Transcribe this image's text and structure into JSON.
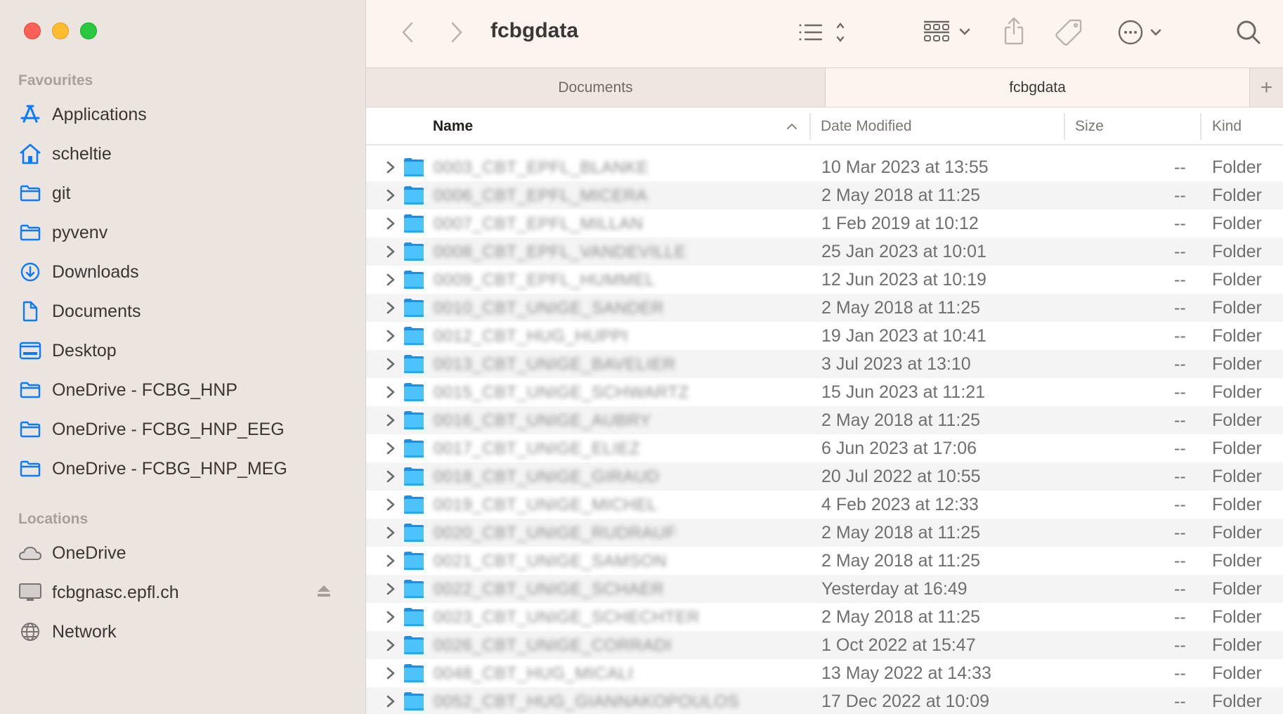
{
  "window": {
    "title": "fcbgdata",
    "controls": [
      "close",
      "minimize",
      "maximize"
    ]
  },
  "sidebar": {
    "favourites_title": "Favourites",
    "favourites": [
      {
        "label": "Applications",
        "icon": "applications-icon"
      },
      {
        "label": "scheltie",
        "icon": "home-icon"
      },
      {
        "label": "git",
        "icon": "folder-icon"
      },
      {
        "label": "pyvenv",
        "icon": "folder-icon"
      },
      {
        "label": "Downloads",
        "icon": "downloads-icon"
      },
      {
        "label": "Documents",
        "icon": "document-icon"
      },
      {
        "label": "Desktop",
        "icon": "desktop-icon"
      },
      {
        "label": "OneDrive - FCBG_HNP",
        "icon": "folder-icon"
      },
      {
        "label": "OneDrive - FCBG_HNP_EEG",
        "icon": "folder-icon"
      },
      {
        "label": "OneDrive - FCBG_HNP_MEG",
        "icon": "folder-icon"
      }
    ],
    "locations_title": "Locations",
    "locations": [
      {
        "label": "OneDrive",
        "icon": "cloud-icon"
      },
      {
        "label": "fcbgnasc.epfl.ch",
        "icon": "network-server-icon",
        "ejectable": true
      },
      {
        "label": "Network",
        "icon": "globe-icon"
      }
    ]
  },
  "toolbar": {
    "back": "back-icon",
    "forward": "forward-icon",
    "view_mode": "list-view-icon",
    "group": "group-icon",
    "share": "share-icon",
    "tag": "tag-icon",
    "more": "more-icon",
    "search": "search-icon"
  },
  "tabs": [
    {
      "label": "Documents",
      "active": false
    },
    {
      "label": "fcbgdata",
      "active": true
    }
  ],
  "tab_add_label": "+",
  "columns": {
    "name": "Name",
    "date": "Date Modified",
    "size": "Size",
    "kind": "Kind",
    "sort_indicator": "^"
  },
  "colors": {
    "accent": "#0a7aff",
    "sidebar_bg": "#ebe4df",
    "toolbar_bg": "#fdf4ef",
    "row_alt": "#f3f4f3",
    "folder": "#3fb8f5"
  },
  "files": [
    {
      "name": "0003_CBT_EPFL_BLANKE",
      "date": "10 Mar 2023 at 13:55",
      "size": "--",
      "kind": "Folder"
    },
    {
      "name": "0006_CBT_EPFL_MICERA",
      "date": "2 May 2018 at 11:25",
      "size": "--",
      "kind": "Folder"
    },
    {
      "name": "0007_CBT_EPFL_MILLAN",
      "date": "1 Feb 2019 at 10:12",
      "size": "--",
      "kind": "Folder"
    },
    {
      "name": "0008_CBT_EPFL_VANDEVILLE",
      "date": "25 Jan 2023 at 10:01",
      "size": "--",
      "kind": "Folder"
    },
    {
      "name": "0009_CBT_EPFL_HUMMEL",
      "date": "12 Jun 2023 at 10:19",
      "size": "--",
      "kind": "Folder"
    },
    {
      "name": "0010_CBT_UNIGE_SANDER",
      "date": "2 May 2018 at 11:25",
      "size": "--",
      "kind": "Folder"
    },
    {
      "name": "0012_CBT_HUG_HUPPI",
      "date": "19 Jan 2023 at 10:41",
      "size": "--",
      "kind": "Folder"
    },
    {
      "name": "0013_CBT_UNIGE_BAVELIER",
      "date": "3 Jul 2023 at 13:10",
      "size": "--",
      "kind": "Folder"
    },
    {
      "name": "0015_CBT_UNIGE_SCHWARTZ",
      "date": "15 Jun 2023 at 11:21",
      "size": "--",
      "kind": "Folder"
    },
    {
      "name": "0016_CBT_UNIGE_AUBRY",
      "date": "2 May 2018 at 11:25",
      "size": "--",
      "kind": "Folder"
    },
    {
      "name": "0017_CBT_UNIGE_ELIEZ",
      "date": "6 Jun 2023 at 17:06",
      "size": "--",
      "kind": "Folder"
    },
    {
      "name": "0018_CBT_UNIGE_GIRAUD",
      "date": "20 Jul 2022 at 10:55",
      "size": "--",
      "kind": "Folder"
    },
    {
      "name": "0019_CBT_UNIGE_MICHEL",
      "date": "4 Feb 2023 at 12:33",
      "size": "--",
      "kind": "Folder"
    },
    {
      "name": "0020_CBT_UNIGE_RUDRAUF",
      "date": "2 May 2018 at 11:25",
      "size": "--",
      "kind": "Folder"
    },
    {
      "name": "0021_CBT_UNIGE_SAMSON",
      "date": "2 May 2018 at 11:25",
      "size": "--",
      "kind": "Folder"
    },
    {
      "name": "0022_CBT_UNIGE_SCHAER",
      "date": "Yesterday at 16:49",
      "size": "--",
      "kind": "Folder"
    },
    {
      "name": "0023_CBT_UNIGE_SCHECHTER",
      "date": "2 May 2018 at 11:25",
      "size": "--",
      "kind": "Folder"
    },
    {
      "name": "0026_CBT_UNIGE_CORRADI",
      "date": "1 Oct 2022 at 15:47",
      "size": "--",
      "kind": "Folder"
    },
    {
      "name": "0048_CBT_HUG_MICALI",
      "date": "13 May 2022 at 14:33",
      "size": "--",
      "kind": "Folder"
    },
    {
      "name": "0052_CBT_HUG_GIANNAKOPOULOS",
      "date": "17 Dec 2022 at 10:09",
      "size": "--",
      "kind": "Folder"
    }
  ]
}
